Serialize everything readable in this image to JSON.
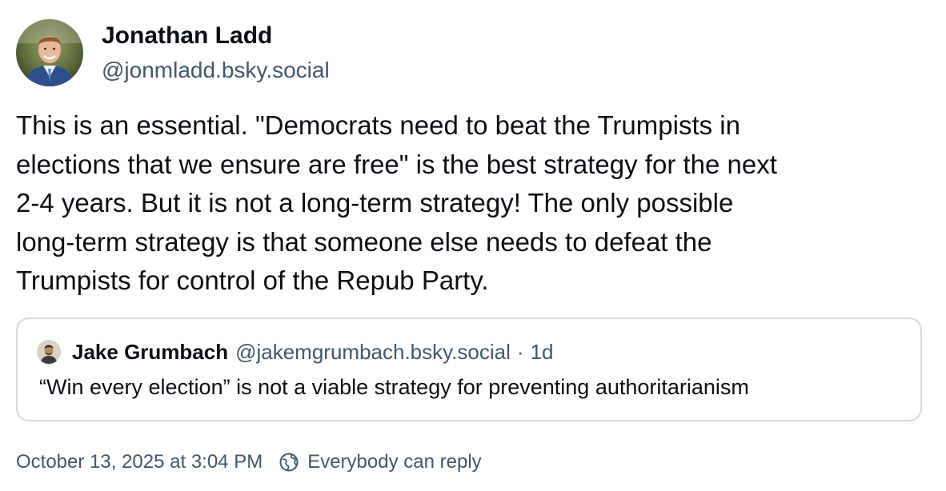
{
  "author": {
    "display_name": "Jonathan Ladd",
    "handle": "@jonmladd.bsky.social"
  },
  "post": {
    "text_lines": [
      "This is an essential. \"Democrats need to beat the Trumpists in",
      "elections that we ensure are free\" is the best strategy for the next",
      "2-4 years. But it is not a long-term strategy! The only possible",
      "long-term strategy is that someone else needs to defeat the",
      "Trumpists for control of the Repub Party."
    ]
  },
  "quote": {
    "display_name": "Jake Grumbach",
    "handle": "@jakemgrumbach.bsky.social",
    "separator": "·",
    "time": "1d",
    "text": "“Win every election” is not a viable strategy for preventing authoritarianism"
  },
  "footer": {
    "timestamp": "October 13, 2025 at 3:04 PM",
    "reply_setting": "Everybody can reply",
    "reply_icon": "globe-icon"
  },
  "colors": {
    "text_primary": "#0b0f14",
    "text_secondary": "#42576c",
    "border": "#d4dbe2"
  }
}
